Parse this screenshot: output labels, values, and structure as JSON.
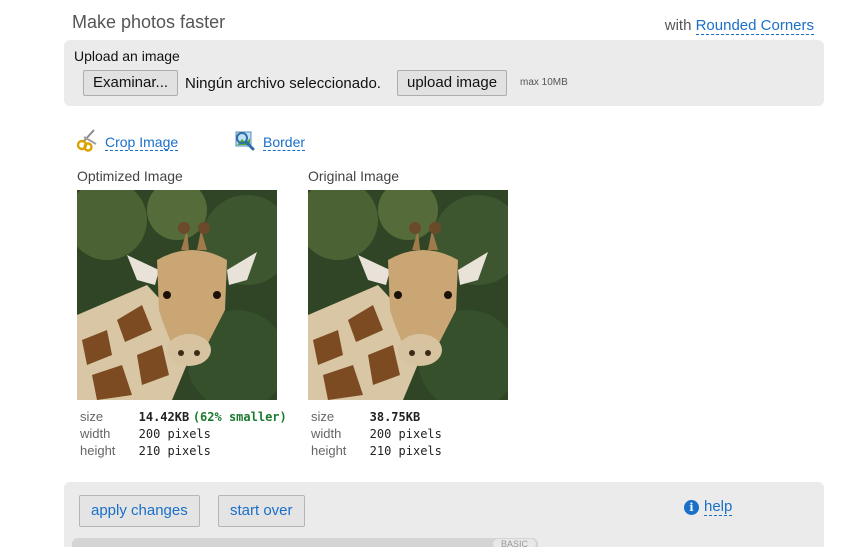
{
  "header": {
    "title": "Make photos faster",
    "with_prefix": "with",
    "with_link": "Rounded Corners"
  },
  "upload": {
    "label": "Upload an image",
    "browse_button": "Examinar...",
    "file_status": "Ningún archivo seleccionado.",
    "upload_button": "upload image",
    "max_size": "max 10MB"
  },
  "tools": {
    "crop_label": "Crop Image",
    "crop_icon": "scissors-icon",
    "border_label": "Border",
    "border_icon": "magnifier-image-icon"
  },
  "optimized": {
    "title": "Optimized Image",
    "size_key": "size",
    "size_value": "14.42KB",
    "savings": "(62% smaller)",
    "width_key": "width",
    "width_value": "200 pixels",
    "height_key": "height",
    "height_value": "210 pixels"
  },
  "original": {
    "title": "Original Image",
    "size_key": "size",
    "size_value": "38.75KB",
    "width_key": "width",
    "width_value": "200 pixels",
    "height_key": "height",
    "height_value": "210 pixels"
  },
  "actions": {
    "apply_button": "apply changes",
    "start_over_button": "start over",
    "help_label": "help",
    "help_icon": "info-icon",
    "slider_tag": "BASIC"
  },
  "colors": {
    "link": "#1a6fc9",
    "savings": "#1c7b2f",
    "panel_bg": "#ebebeb"
  }
}
